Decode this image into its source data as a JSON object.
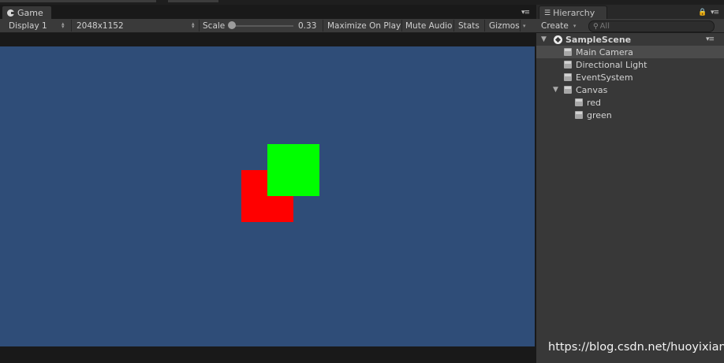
{
  "game": {
    "tab_label": "Game",
    "toolbar": {
      "display": "Display 1",
      "resolution": "2048x1152",
      "scale_label": "Scale",
      "scale_value": "0.33",
      "maximize": "Maximize On Play",
      "mute": "Mute Audio",
      "stats": "Stats",
      "gizmos": "Gizmos"
    },
    "scene": {
      "background": "#2f4d78",
      "squares": [
        {
          "name": "red",
          "color": "#ff0000"
        },
        {
          "name": "green",
          "color": "#00ff00"
        }
      ]
    }
  },
  "hierarchy": {
    "tab_label": "Hierarchy",
    "create_label": "Create",
    "search_placeholder": "All",
    "scene_name": "SampleScene",
    "items": [
      {
        "label": "Main Camera",
        "selected": true
      },
      {
        "label": "Directional Light"
      },
      {
        "label": "EventSystem"
      },
      {
        "label": "Canvas",
        "expanded": true
      },
      {
        "label": "red"
      },
      {
        "label": "green"
      }
    ]
  },
  "watermark": "https://blog.csdn.net/huoyixian"
}
